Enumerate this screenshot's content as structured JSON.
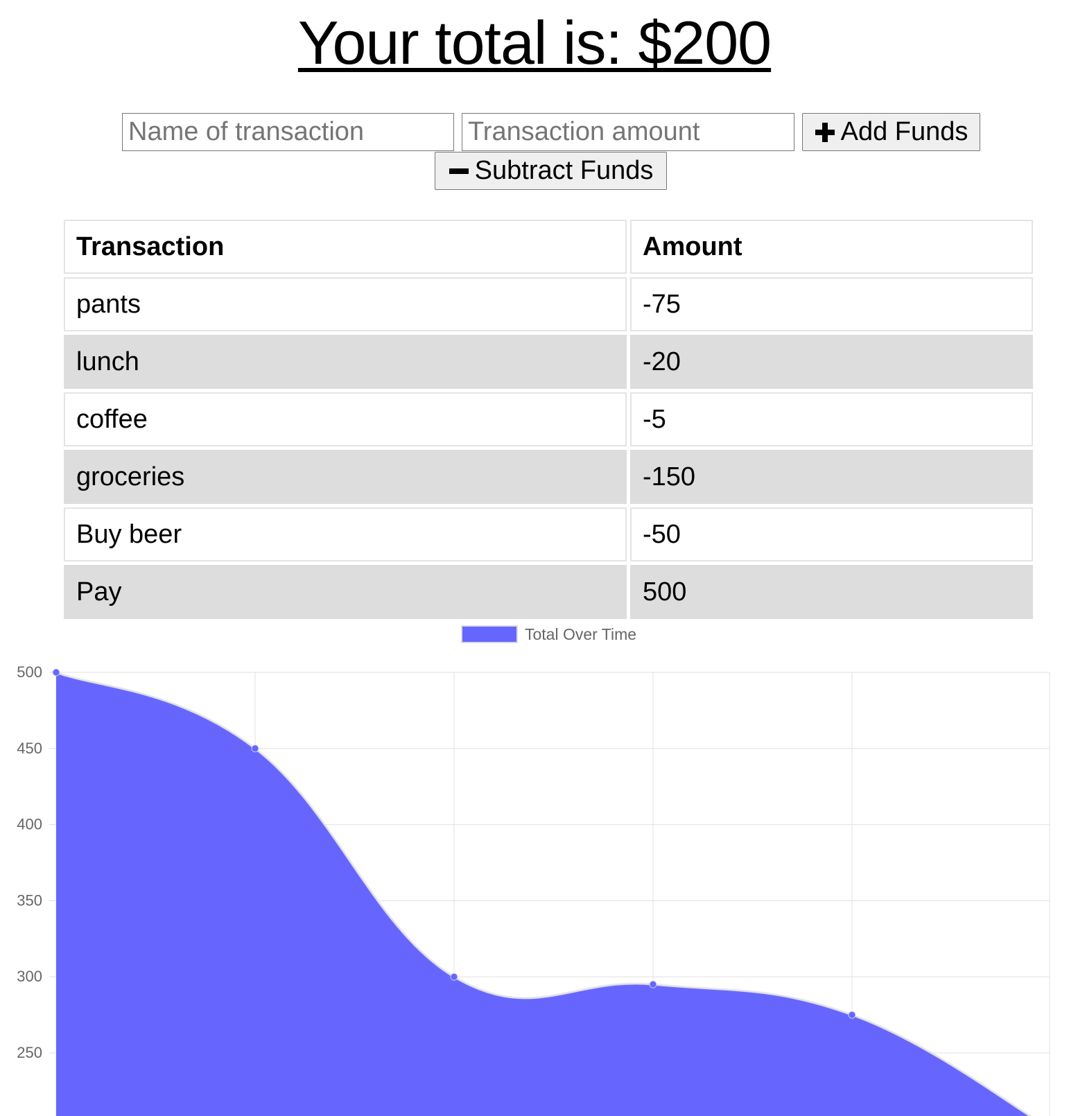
{
  "header": {
    "title": "Your total is: $200"
  },
  "form": {
    "name_placeholder": "Name of transaction",
    "amount_placeholder": "Transaction amount",
    "add_label": "Add Funds",
    "subtract_label": "Subtract Funds"
  },
  "table": {
    "headers": [
      "Transaction",
      "Amount"
    ],
    "rows": [
      {
        "name": "pants",
        "amount": "-75"
      },
      {
        "name": "lunch",
        "amount": "-20"
      },
      {
        "name": "coffee",
        "amount": "-5"
      },
      {
        "name": "groceries",
        "amount": "-150"
      },
      {
        "name": "Buy beer",
        "amount": "-50"
      },
      {
        "name": "Pay",
        "amount": "500"
      }
    ]
  },
  "chart_data": {
    "type": "area",
    "legend": [
      "Total Over Time"
    ],
    "legend_position": "top",
    "series": [
      {
        "name": "Total Over Time",
        "color": "#6666ff",
        "values": [
          500,
          450,
          300,
          295,
          275,
          200
        ]
      }
    ],
    "y_ticks": [
      "500",
      "450",
      "400",
      "350",
      "300",
      "250"
    ],
    "ylim": [
      220,
      500
    ],
    "grid": true
  },
  "colors": {
    "series_fill": "#6666ff",
    "grid": "#e0e0e0",
    "tick_text": "#666666"
  }
}
